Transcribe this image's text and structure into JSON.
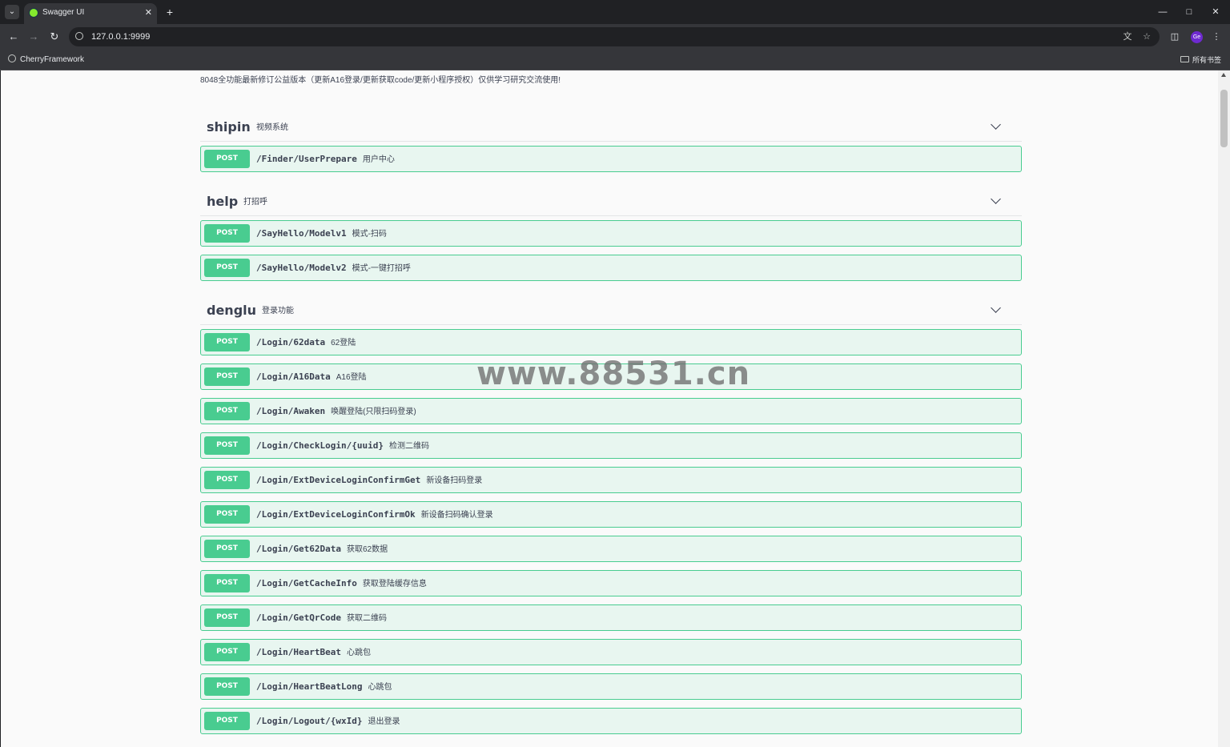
{
  "browser": {
    "tab_title": "Swagger UI",
    "url": "127.0.0.1:9999",
    "bookmark": "CherryFramework",
    "all_bookmarks": "所有书签",
    "profile_initials": "Ge"
  },
  "page": {
    "description": "8048全功能最新修订公益版本（更新A16登录/更新获取code/更新小程序授权）仅供学习研究交流使用!",
    "watermark": "www.88531.cn"
  },
  "tags": [
    {
      "name": "shipin",
      "description": "视频系统",
      "operations": [
        {
          "method": "POST",
          "path": "/Finder/UserPrepare",
          "summary": "用户中心"
        }
      ]
    },
    {
      "name": "help",
      "description": "打招呼",
      "operations": [
        {
          "method": "POST",
          "path": "/SayHello/Modelv1",
          "summary": "模式-扫码"
        },
        {
          "method": "POST",
          "path": "/SayHello/Modelv2",
          "summary": "模式-一键打招呼"
        }
      ]
    },
    {
      "name": "denglu",
      "description": "登录功能",
      "operations": [
        {
          "method": "POST",
          "path": "/Login/62data",
          "summary": "62登陆"
        },
        {
          "method": "POST",
          "path": "/Login/A16Data",
          "summary": "A16登陆"
        },
        {
          "method": "POST",
          "path": "/Login/Awaken",
          "summary": "唤醒登陆(只限扫码登录)"
        },
        {
          "method": "POST",
          "path": "/Login/CheckLogin/{uuid}",
          "summary": "检测二维码"
        },
        {
          "method": "POST",
          "path": "/Login/ExtDeviceLoginConfirmGet",
          "summary": "新设备扫码登录"
        },
        {
          "method": "POST",
          "path": "/Login/ExtDeviceLoginConfirmOk",
          "summary": "新设备扫码确认登录"
        },
        {
          "method": "POST",
          "path": "/Login/Get62Data",
          "summary": "获取62数据"
        },
        {
          "method": "POST",
          "path": "/Login/GetCacheInfo",
          "summary": "获取登陆缓存信息"
        },
        {
          "method": "POST",
          "path": "/Login/GetQrCode",
          "summary": "获取二维码"
        },
        {
          "method": "POST",
          "path": "/Login/HeartBeat",
          "summary": "心跳包"
        },
        {
          "method": "POST",
          "path": "/Login/HeartBeatLong",
          "summary": "心跳包"
        },
        {
          "method": "POST",
          "path": "/Login/Logout/{wxId}",
          "summary": "退出登录"
        }
      ]
    }
  ],
  "colors": {
    "post": "#49cc90",
    "post_bg": "#e8f6f0",
    "text": "#3b4151"
  }
}
